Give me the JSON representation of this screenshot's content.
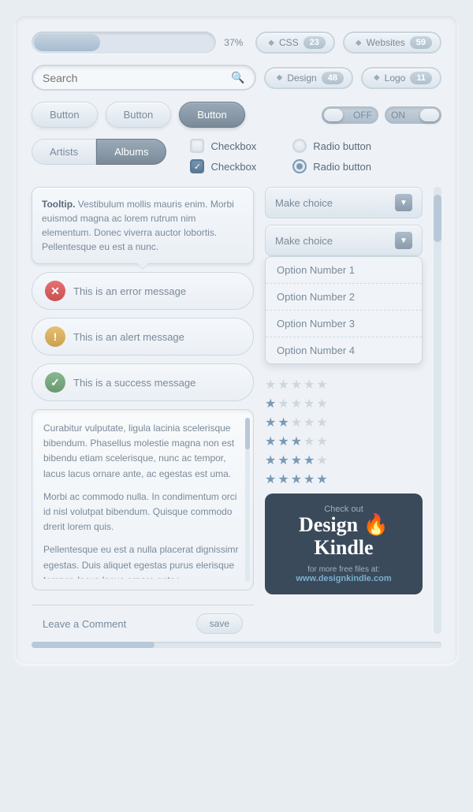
{
  "progress": {
    "percent": "37%",
    "fill_width": "37%"
  },
  "tags": [
    {
      "id": "css",
      "label": "CSS",
      "count": "23"
    },
    {
      "id": "websites",
      "label": "Websites",
      "count": "59"
    },
    {
      "id": "design",
      "label": "Design",
      "count": "48"
    },
    {
      "id": "logo",
      "label": "Logo",
      "count": "11"
    }
  ],
  "search": {
    "placeholder": "Search"
  },
  "buttons": [
    {
      "id": "btn1",
      "label": "Button",
      "style": "light"
    },
    {
      "id": "btn2",
      "label": "Button",
      "style": "light"
    },
    {
      "id": "btn3",
      "label": "Button",
      "style": "dark"
    }
  ],
  "toggles": [
    {
      "id": "toggle-off",
      "label": "OFF",
      "state": "off"
    },
    {
      "id": "toggle-on",
      "label": "ON",
      "state": "on"
    }
  ],
  "tabs": [
    {
      "id": "artists",
      "label": "Artists",
      "active": false
    },
    {
      "id": "albums",
      "label": "Albums",
      "active": true
    }
  ],
  "checkboxes": [
    {
      "id": "cb1",
      "label": "Checkbox",
      "checked": false
    },
    {
      "id": "cb2",
      "label": "Checkbox",
      "checked": true
    }
  ],
  "radios": [
    {
      "id": "rb1",
      "label": "Radio button",
      "checked": false
    },
    {
      "id": "rb2",
      "label": "Radio button",
      "checked": true
    }
  ],
  "tooltip": {
    "bold_text": "Tooltip.",
    "body": " Vestibulum mollis mauris enim. Morbi euismod magna ac lorem rutrum nim elementum. Donec viverra auctor lobortis. Pellentesque eu est a nunc."
  },
  "alerts": [
    {
      "id": "error",
      "type": "error",
      "message": "This is an error message",
      "icon": "✕"
    },
    {
      "id": "alert",
      "type": "warn",
      "message": "This is an alert message",
      "icon": "!"
    },
    {
      "id": "success",
      "type": "success",
      "message": "This is a success message",
      "icon": "✓"
    }
  ],
  "dropdown1": {
    "placeholder": "Make choice",
    "options": []
  },
  "dropdown2": {
    "placeholder": "Make choice",
    "is_open": true,
    "options": [
      {
        "id": "opt1",
        "label": "Option Number 1"
      },
      {
        "id": "opt2",
        "label": "Option Number 2"
      },
      {
        "id": "opt3",
        "label": "Option Number 3"
      },
      {
        "id": "opt4",
        "label": "Option Number 4"
      }
    ]
  },
  "stars": [
    {
      "filled": 0,
      "total": 5
    },
    {
      "filled": 1,
      "total": 5
    },
    {
      "filled": 2,
      "total": 5
    },
    {
      "filled": 3,
      "total": 5
    },
    {
      "filled": 4,
      "total": 5
    },
    {
      "filled": 5,
      "total": 5
    }
  ],
  "comment": {
    "text1": "Curabitur vulputate, ligula lacinia scelerisque bibendum. Phasellus molestie magna non est bibendu etiam scelerisque, nunc ac tempor, lacus lacus ornare ante, ac egestas est uma.",
    "text2": "Morbi ac commodo nulla. In condimentum orci id nisl volutpat bibendum. Quisque commodo drerit lorem quis.",
    "text3": "Pellentesque eu est a nulla placerat dignissimr egestas. Duis aliquet egestas purus elerisque tempor, lacus lacus ornare antac.",
    "footer_label": "Leave a Comment",
    "save_btn": "save"
  },
  "dk_ad": {
    "check_out": "Check out",
    "title_line1": "Design",
    "title_line2": "Kindle",
    "subtitle": "for more free files at:",
    "url": "www.designkindle.com",
    "flame": "🔥"
  }
}
